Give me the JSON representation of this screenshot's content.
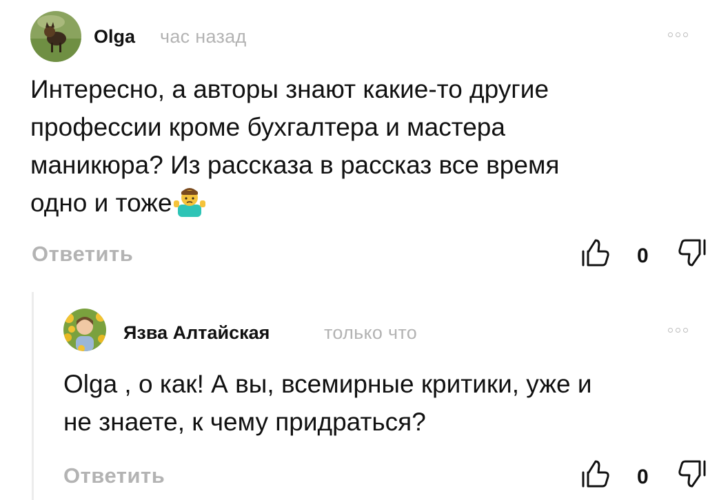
{
  "comments": [
    {
      "author": "Olga",
      "time": "час назад",
      "text_lines": [
        "Интересно, а авторы знают какие-то другие",
        "профессии кроме бухгалтера и мастера",
        "маникюра? Из рассказа в рассказ все время",
        "одно и тоже"
      ],
      "emoji": "man-shrugging-emoji",
      "reply_label": "Ответить",
      "likes": "0",
      "avatar_icon": "dog-photo-avatar"
    },
    {
      "author": "Язва Алтайская",
      "time": "только что",
      "text_lines": [
        "Olga , о как! А вы, всемирные критики, уже и",
        "не знаете, к чему придраться?"
      ],
      "reply_label": "Ответить",
      "likes": "0",
      "avatar_icon": "child-sunflowers-avatar"
    }
  ],
  "icons": {
    "like": "thumb-up-icon",
    "dislike": "thumb-down-icon",
    "more": "more-dots-icon"
  },
  "colors": {
    "muted": "#b3b3b3",
    "text": "#111111",
    "thread_line": "#ececec"
  }
}
